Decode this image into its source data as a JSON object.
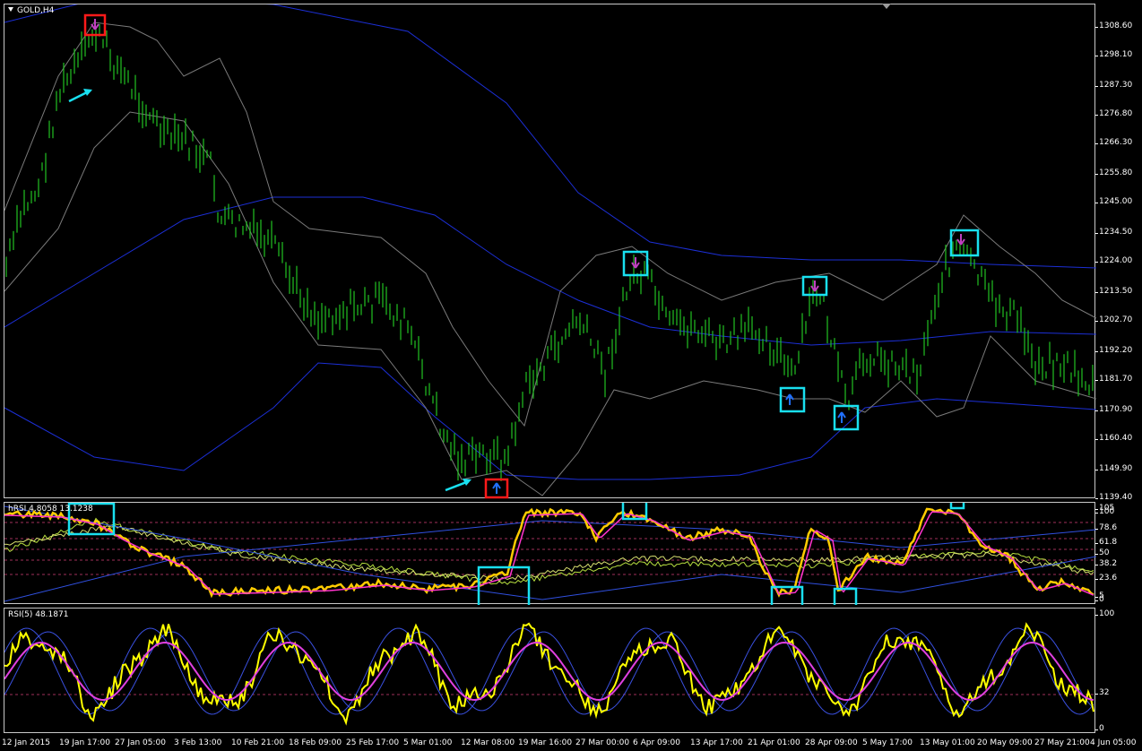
{
  "chart": {
    "symbol_label": "GOLD,H4",
    "hrsi_label": "hRSI 4.8058 13.1238",
    "rsi_label": "RSI(5) 48.1871"
  },
  "price_axis": [
    "1308.60",
    "1298.10",
    "1287.30",
    "1276.80",
    "1266.30",
    "1255.80",
    "1245.00",
    "1234.50",
    "1224.00",
    "1213.50",
    "1202.70",
    "1192.20",
    "1181.70",
    "1170.90",
    "1160.40",
    "1149.90",
    "1139.40"
  ],
  "hrsi_axis": [
    "105",
    "100",
    "78.6",
    "61.8",
    "50",
    "38.2",
    "23.6",
    "5",
    "0"
  ],
  "rsi_axis": [
    "100",
    "32",
    "0"
  ],
  "time_axis": [
    "12 Jan 2015",
    "19 Jan 17:00",
    "27 Jan 05:00",
    "3 Feb 13:00",
    "10 Feb 21:00",
    "18 Feb 09:00",
    "25 Feb 17:00",
    "5 Mar 01:00",
    "12 Mar 08:00",
    "19 Mar 16:00",
    "27 Mar 00:00",
    "6 Apr 09:00",
    "13 Apr 17:00",
    "21 Apr 01:00",
    "28 Apr 09:00",
    "5 May 17:00",
    "13 May 01:00",
    "20 May 09:00",
    "27 May 21:00",
    "4 Jun 05:00"
  ],
  "colors": {
    "background": "#000000",
    "candles": "#22c322",
    "bands_outer": "#1c2fd6",
    "bands_inner": "#7a7a7a",
    "marker_red": "#ff1a1a",
    "marker_cyan": "#19e0f0",
    "hrsi_line": "#ffcc00",
    "hrsi_signal": "#ff33cc",
    "rsi_line": "#ffff00",
    "rsi_signal": "#e040e0",
    "level_line": "#a0305a"
  },
  "icons": [
    "down-arrow-icon",
    "up-arrow-icon",
    "pointer-arrow-icon"
  ]
}
